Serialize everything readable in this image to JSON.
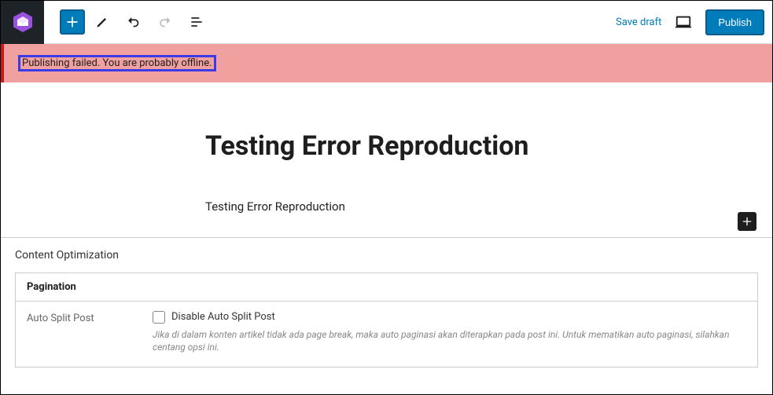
{
  "toolbar": {
    "save_draft": "Save draft",
    "publish": "Publish"
  },
  "notice": {
    "text": "Publishing failed. You are probably offline."
  },
  "post": {
    "title": "Testing Error Reproduction",
    "body": "Testing Error Reproduction"
  },
  "metabox": {
    "section_heading": "Content Optimization",
    "pagination": {
      "title": "Pagination",
      "auto_split_label": "Auto Split Post",
      "checkbox_label": "Disable Auto Split Post",
      "description": "Jika di dalam konten artikel tidak ada page break, maka auto paginasi akan diterapkan pada post ini. Untuk mematikan auto paginasi, silahkan centang opsi ini."
    }
  }
}
